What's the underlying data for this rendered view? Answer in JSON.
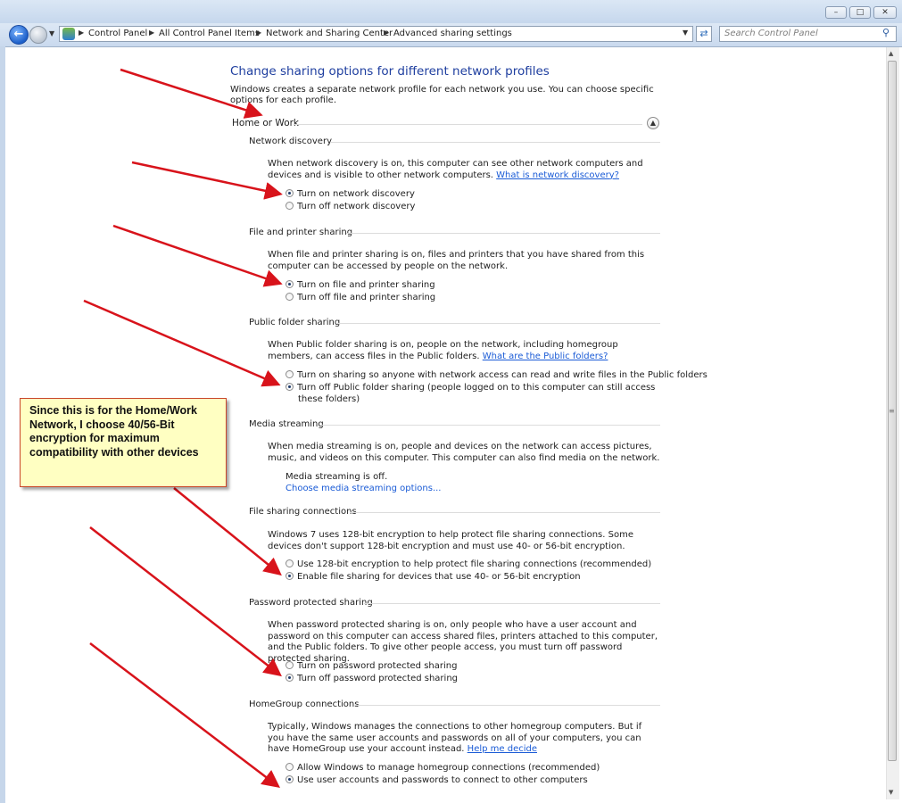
{
  "window": {
    "minimize_icon": "minimize-icon",
    "maximize_icon": "maximize-icon",
    "close_icon": "close-icon"
  },
  "nav": {
    "breadcrumbs": [
      "Control Panel",
      "All Control Panel Items",
      "Network and Sharing Center",
      "Advanced sharing settings"
    ],
    "search_placeholder": "Search Control Panel"
  },
  "page": {
    "title": "Change sharing options for different network profiles",
    "intro": "Windows creates a separate network profile for each network you use. You can choose specific options for each profile.",
    "profile": "Home or Work"
  },
  "sections": {
    "discovery": {
      "title": "Network discovery",
      "desc": "When network discovery is on, this computer can see other network computers and devices and is visible to other network computers.",
      "link": "What is network discovery?",
      "options": [
        "Turn on network discovery",
        "Turn off network discovery"
      ],
      "selected": 0
    },
    "fileprinter": {
      "title": "File and printer sharing",
      "desc": "When file and printer sharing is on, files and printers that you have shared from this computer can be accessed by people on the network.",
      "options": [
        "Turn on file and printer sharing",
        "Turn off file and printer sharing"
      ],
      "selected": 0
    },
    "public": {
      "title": "Public folder sharing",
      "desc": "When Public folder sharing is on, people on the network, including homegroup members, can access files in the Public folders.",
      "link": "What are the Public folders?",
      "options": [
        "Turn on sharing so anyone with network access can read and write files in the Public folders",
        "Turn off Public folder sharing (people logged on to this computer can still access these folders)"
      ],
      "selected": 1
    },
    "media": {
      "title": "Media streaming",
      "desc": "When media streaming is on, people and devices on the network can access pictures, music, and videos on this computer. This computer can also find media on the network.",
      "status": "Media streaming is off.",
      "link": "Choose media streaming options..."
    },
    "encryption": {
      "title": "File sharing connections",
      "desc": "Windows 7 uses 128-bit encryption to help protect file sharing connections. Some devices don't support 128-bit encryption and must use 40- or 56-bit encryption.",
      "options": [
        "Use 128-bit encryption to help protect file sharing connections (recommended)",
        "Enable file sharing for devices that use 40- or 56-bit encryption"
      ],
      "selected": 1
    },
    "password": {
      "title": "Password protected sharing",
      "desc": "When password protected sharing is on, only people who have a user account and password on this computer can access shared files, printers attached to this computer, and the Public folders. To give other people access, you must turn off password protected sharing.",
      "options": [
        "Turn on password protected sharing",
        "Turn off password protected sharing"
      ],
      "selected": 1
    },
    "homegroup": {
      "title": "HomeGroup connections",
      "desc": "Typically, Windows manages the connections to other homegroup computers. But if you have the same user accounts and passwords on all of your computers, you can have HomeGroup use your account instead.",
      "link": "Help me decide",
      "options": [
        "Allow Windows to manage homegroup connections (recommended)",
        "Use user accounts and passwords to connect to other computers"
      ],
      "selected": 1
    }
  },
  "callout": {
    "text": "Since this is for the Home/Work Network, I choose 40/56-Bit encryption for maximum compatibility with other devices"
  },
  "colors": {
    "heading": "#1e3e9f",
    "link": "#1a5bd6",
    "arrow": "#d8131b",
    "callout_bg": "#ffffc2"
  }
}
